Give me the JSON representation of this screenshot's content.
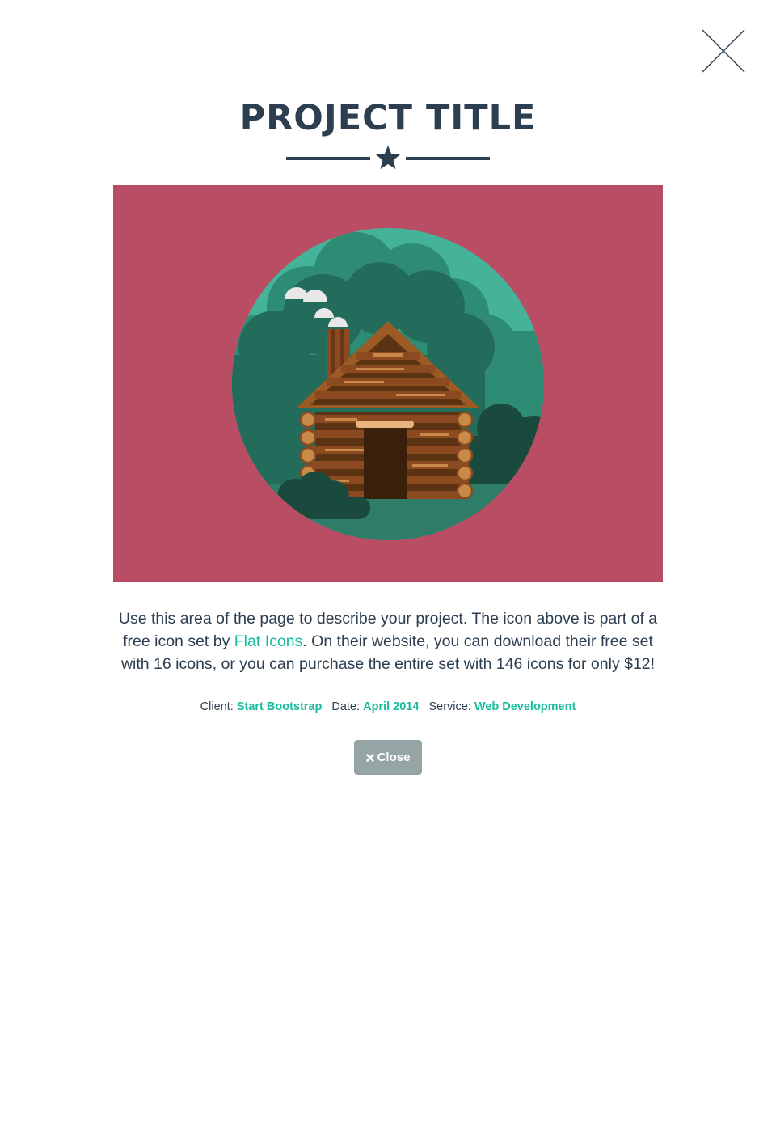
{
  "modal": {
    "title": "PROJECT TITLE",
    "description": {
      "before_link": "Use this area of the page to describe your project. The icon above is part of a free icon set by ",
      "link_text": "Flat Icons",
      "after_link": ". On their website, you can download their free set with 16 icons, or you can purchase the entire set with 146 icons for only $12!"
    },
    "meta": {
      "client_label": "Client:",
      "client_value": "Start Bootstrap",
      "date_label": "Date:",
      "date_value": "April 2014",
      "service_label": "Service:",
      "service_value": "Web Development"
    },
    "close_button_label": "Close",
    "icons": {
      "dismiss": "close-x-icon",
      "divider": "star-icon",
      "button": "times-icon",
      "hero": "log-cabin-illustration"
    }
  },
  "colors": {
    "heading": "#2c3e50",
    "accent": "#18bc9c",
    "hero_background": "#b94d63",
    "button": "#95a5a6"
  }
}
